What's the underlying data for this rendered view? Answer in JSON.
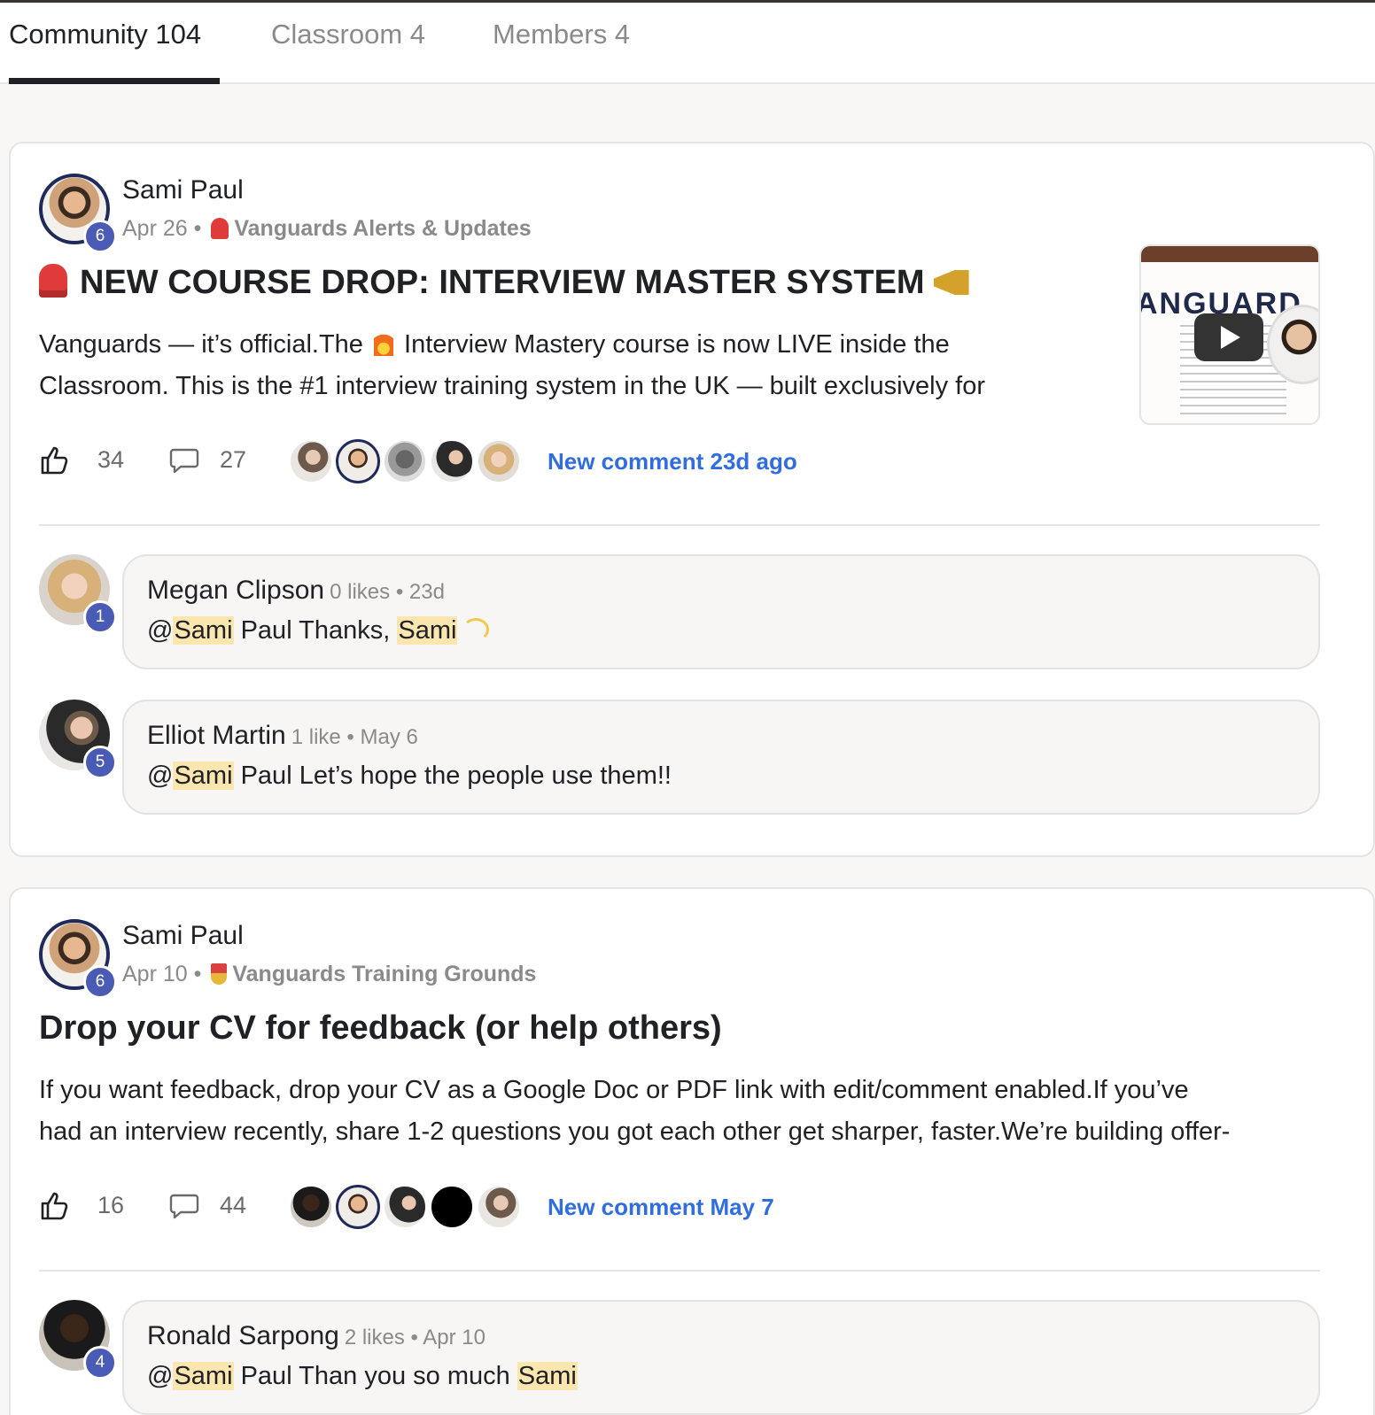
{
  "tabs": [
    {
      "label": "Community 104",
      "active": true
    },
    {
      "label": "Classroom 4",
      "active": false
    },
    {
      "label": "Members 4",
      "active": false
    }
  ],
  "posts": [
    {
      "author": "Sami Paul",
      "level": "6",
      "date": "Apr 26",
      "separator": "•",
      "category": "Vanguards Alerts & Updates",
      "category_icon": "alarm-light-icon",
      "title": "NEW COURSE DROP: INTERVIEW MASTER SYSTEM",
      "body_line1_a": "Vanguards — it’s official.The",
      "body_line1_b": "Interview Mastery course is now LIVE inside the",
      "body_line2": "Classroom. This is the #1 interview training system in the UK — built exclusively for",
      "thumbnail_brand": "ANGUARD",
      "likes": "34",
      "comments": "27",
      "new_comment": "New comment 23d ago",
      "replies": [
        {
          "author": "Megan Clipson",
          "level": "1",
          "meta": "0 likes • 23d",
          "at": "@",
          "mention1": "Sami",
          "text_mid": " Paul Thanks, ",
          "mention2": "Sami",
          "text_end": ""
        },
        {
          "author": "Elliot Martin",
          "level": "5",
          "meta": "1 like • May 6",
          "at": "@",
          "mention1": "Sami",
          "text_mid": " Paul Let’s hope the people use them!!",
          "mention2": "",
          "text_end": ""
        }
      ]
    },
    {
      "author": "Sami Paul",
      "level": "6",
      "date": "Apr 10",
      "separator": "•",
      "category": "Vanguards Training Grounds",
      "category_icon": "medal-icon",
      "title": "Drop your CV for feedback (or help others)",
      "body_line1": "If you want feedback, drop your CV as a Google Doc or PDF link with edit/comment enabled.If you’ve",
      "body_line2": "had an interview recently, share 1-2 questions you got each other get sharper, faster.We’re building offer-",
      "likes": "16",
      "comments": "44",
      "new_comment": "New comment May 7",
      "replies": [
        {
          "author": "Ronald Sarpong",
          "level": "4",
          "meta": "2 likes • Apr 10",
          "at": "@",
          "mention1": "Sami",
          "text_mid": " Paul Than you so much ",
          "mention2": "Sami",
          "text_end": ""
        }
      ]
    }
  ],
  "colors": {
    "accent_link": "#2f6de1",
    "level_badge": "#4a5bb5",
    "mention_highlight": "#fbe6b0"
  }
}
